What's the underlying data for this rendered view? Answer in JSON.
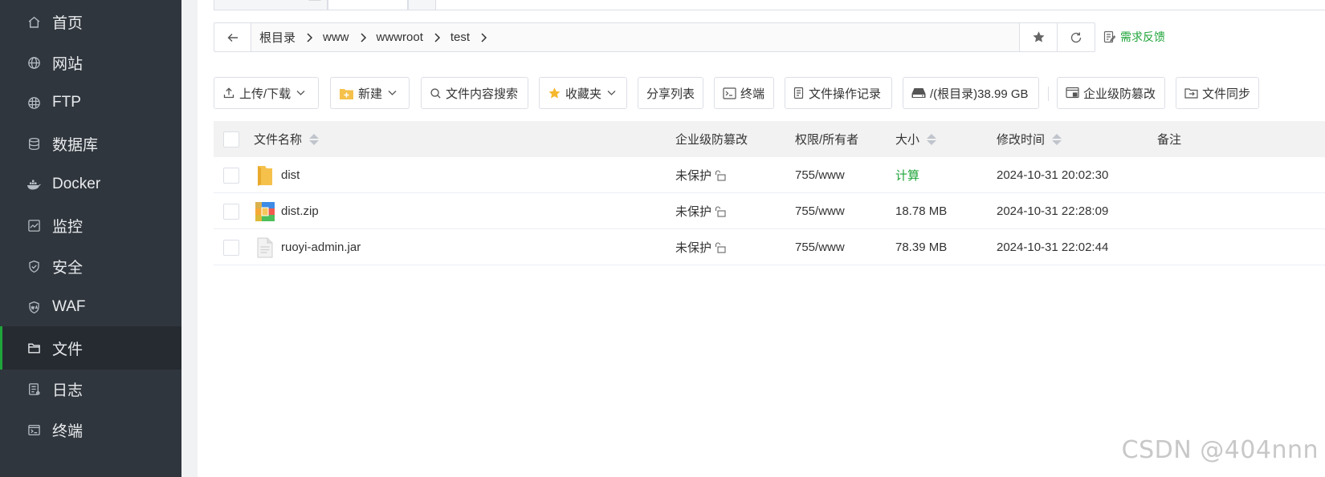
{
  "sidebar": {
    "items": [
      {
        "label": "首页",
        "icon": "home-icon"
      },
      {
        "label": "网站",
        "icon": "globe-icon"
      },
      {
        "label": "FTP",
        "icon": "globe-ftp-icon"
      },
      {
        "label": "数据库",
        "icon": "database-icon"
      },
      {
        "label": "Docker",
        "icon": "docker-icon"
      },
      {
        "label": "监控",
        "icon": "monitor-icon"
      },
      {
        "label": "安全",
        "icon": "shield-icon"
      },
      {
        "label": "WAF",
        "icon": "waf-shield-icon"
      },
      {
        "label": "文件",
        "icon": "folder-icon",
        "active": true
      },
      {
        "label": "日志",
        "icon": "log-icon"
      },
      {
        "label": "终端",
        "icon": "terminal-icon"
      }
    ]
  },
  "breadcrumb": {
    "segments": [
      "根目录",
      "www",
      "wwwroot",
      "test"
    ]
  },
  "feedback_label": "需求反馈",
  "toolbar": {
    "upload_download": "上传/下载",
    "new": "新建",
    "content_search": "文件内容搜索",
    "favorites": "收藏夹",
    "share_list": "分享列表",
    "terminal": "终端",
    "operation_log": "文件操作记录",
    "disk": "/(根目录)38.99 GB",
    "tamper_proof": "企业级防篡改",
    "file_sync": "文件同步"
  },
  "table": {
    "headers": {
      "name": "文件名称",
      "tamper": "企业级防篡改",
      "perm": "权限/所有者",
      "size": "大小",
      "mtime": "修改时间",
      "note": "备注"
    },
    "rows": [
      {
        "name": "dist",
        "type": "folder",
        "tamper": "未保护",
        "perm": "755/www",
        "size": "计算",
        "mtime": "2024-10-31 20:02:30",
        "note": ""
      },
      {
        "name": "dist.zip",
        "type": "zip",
        "tamper": "未保护",
        "perm": "755/www",
        "size": "18.78 MB",
        "mtime": "2024-10-31 22:28:09",
        "note": ""
      },
      {
        "name": "ruoyi-admin.jar",
        "type": "file",
        "tamper": "未保护",
        "perm": "755/www",
        "size": "78.39 MB",
        "mtime": "2024-10-31 22:02:44",
        "note": ""
      }
    ]
  },
  "watermark": "CSDN @404nnn",
  "colors": {
    "accent": "#20a53a",
    "sidebar_bg": "#30363d",
    "sidebar_active_bg": "#262b31"
  }
}
